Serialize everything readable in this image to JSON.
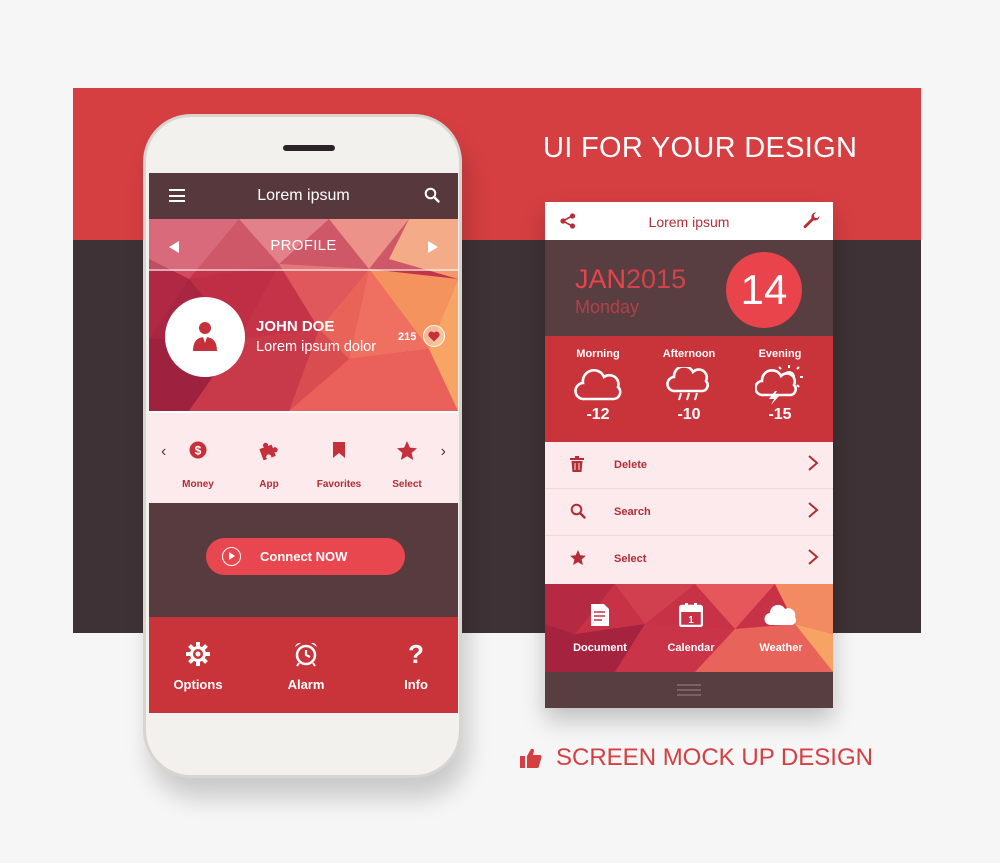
{
  "poster": {
    "headline": "UI FOR YOUR DESIGN",
    "footer_text": "SCREEN MOCK UP DESIGN"
  },
  "phone": {
    "topbar_title": "Lorem ipsum",
    "profile_label": "PROFILE",
    "user_name": "JOHN DOE",
    "user_subtitle": "Lorem ipsum dolor",
    "likes_count": "215",
    "strip": {
      "prev": "‹",
      "next": "›",
      "items": [
        {
          "label": "Money"
        },
        {
          "label": "App"
        },
        {
          "label": "Favorites"
        },
        {
          "label": "Select"
        }
      ]
    },
    "connect_label": "Connect NOW",
    "bottom": [
      {
        "label": "Options"
      },
      {
        "label": "Alarm"
      },
      {
        "label": "Info"
      }
    ]
  },
  "card": {
    "topbar_title": "Lorem ipsum",
    "month": "JAN",
    "year": "2015",
    "weekday": "Monday",
    "day_number": "14",
    "weather": [
      {
        "name": "Morning",
        "temp": "-12"
      },
      {
        "name": "Afternoon",
        "temp": "-10"
      },
      {
        "name": "Evening",
        "temp": "-15"
      }
    ],
    "list": [
      {
        "label": "Delete"
      },
      {
        "label": "Search"
      },
      {
        "label": "Select"
      }
    ],
    "tiles": [
      {
        "label": "Document"
      },
      {
        "label": "Calendar"
      },
      {
        "label": "Weather"
      }
    ]
  },
  "colors": {
    "brand_red": "#d63f42",
    "dark_plum": "#3f3236",
    "accent_pink": "#e9474f"
  }
}
